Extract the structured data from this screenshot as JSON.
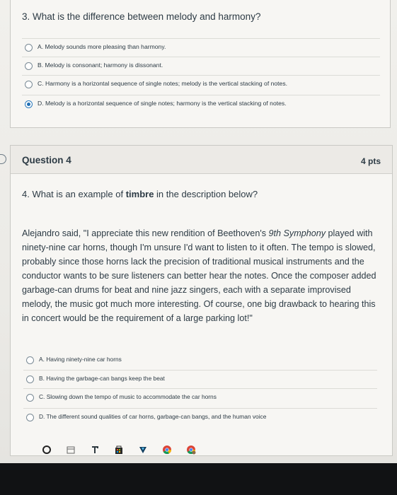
{
  "question3": {
    "text": "3. What is the difference between melody and harmony?",
    "answers": [
      {
        "label": "A. Melody sounds more pleasing than harmony.",
        "selected": false
      },
      {
        "label": "B. Melody is consonant; harmony is dissonant.",
        "selected": false
      },
      {
        "label": "C. Harmony is a horizontal sequence of single notes; melody is the vertical stacking of notes.",
        "selected": false
      },
      {
        "label": "D. Melody is a horizontal sequence of single notes; harmony is the vertical stacking of notes.",
        "selected": true
      }
    ]
  },
  "question4": {
    "title": "Question 4",
    "points": "4 pts",
    "prompt_prefix": "4. What is an example of ",
    "prompt_bold": "timbre",
    "prompt_suffix": " in the description below?",
    "passage_before_title": "Alejandro said, \"I appreciate this new rendition of Beethoven's ",
    "passage_title": "9th Symphony",
    "passage_after_title": " played with ninety-nine car horns, though I'm unsure I'd want to listen to it often.  The tempo is slowed, probably since those horns lack the precision of traditional musical instruments and the conductor wants to be sure listeners can better hear the notes.  Once the composer added garbage-can drums for beat and nine jazz singers, each with a separate improvised melody, the music got much more interesting.  Of course, one big drawback to hearing this in concert would be the requirement of a large parking lot!\"",
    "answers": [
      {
        "label": "A. Having ninety-nine car horns",
        "selected": false
      },
      {
        "label": "B. Having the garbage-can bangs keep the beat",
        "selected": false
      },
      {
        "label": "C. Slowing down the tempo of music to accommodate the car horns",
        "selected": false
      },
      {
        "label": "D. The different sound qualities of car horns, garbage-can bangs, and the human voice",
        "selected": false
      }
    ]
  },
  "taskbar": {
    "icons": [
      "circle-icon",
      "calendar-icon",
      "screen-icon",
      "store-icon",
      "vpn-icon",
      "chrome-icon",
      "chrome-profile-icon"
    ]
  }
}
